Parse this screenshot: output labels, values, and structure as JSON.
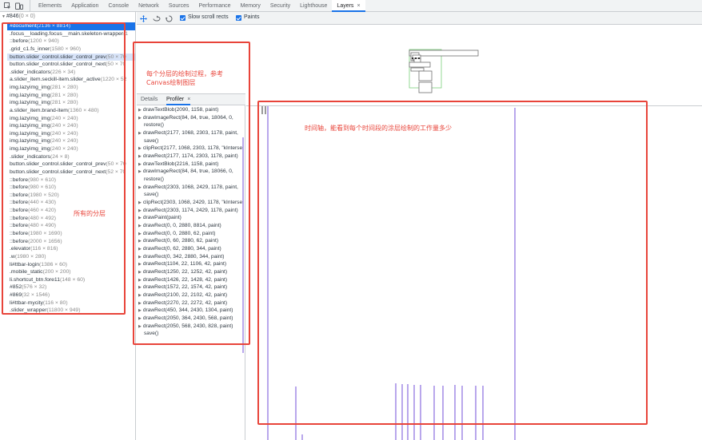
{
  "toolbar": {
    "tabs": [
      {
        "label": "Elements",
        "active": false
      },
      {
        "label": "Application",
        "active": false
      },
      {
        "label": "Console",
        "active": false
      },
      {
        "label": "Network",
        "active": false
      },
      {
        "label": "Sources",
        "active": false
      },
      {
        "label": "Performance",
        "active": false
      },
      {
        "label": "Memory",
        "active": false
      },
      {
        "label": "Security",
        "active": false
      },
      {
        "label": "Lighthouse",
        "active": false
      },
      {
        "label": "Layers",
        "active": true
      }
    ],
    "close_glyph": "×"
  },
  "layer_tree": {
    "root": "#846",
    "root_size": "(0 × 0)",
    "rows": [
      {
        "name": "#document",
        "size": "(2136 × 8814)",
        "selected": true
      },
      {
        "name": ".focus__loading.focus__main.skeleton-wrapper",
        "size": "(1",
        "selected": false
      },
      {
        "name": "::before",
        "size": "(1200 × 940)"
      },
      {
        "name": ".grid_c1.fs_inner",
        "size": "(1580 × 960)"
      },
      {
        "name": "button.slider_control.slider_control_prev",
        "size": "(50 × 70",
        "hover": true
      },
      {
        "name": "button.slider_control.slider_control_next",
        "size": "(50 × 70"
      },
      {
        "name": ".slider_indicators",
        "size": "(226 × 34)"
      },
      {
        "name": "a.slider_item.seckill-item.slider_active",
        "size": "(1220 × 52"
      },
      {
        "name": "img.lazyimg_img",
        "size": "(281 × 280)"
      },
      {
        "name": "img.lazyimg_img",
        "size": "(281 × 280)"
      },
      {
        "name": "img.lazyimg_img",
        "size": "(281 × 280)"
      },
      {
        "name": "a.slider_item.brand-item",
        "size": "(1360 × 480)"
      },
      {
        "name": "img.lazyimg_img",
        "size": "(240 × 240)"
      },
      {
        "name": "img.lazyimg_img",
        "size": "(240 × 240)"
      },
      {
        "name": "img.lazyimg_img",
        "size": "(240 × 240)"
      },
      {
        "name": "img.lazyimg_img",
        "size": "(240 × 240)"
      },
      {
        "name": "img.lazyimg_img",
        "size": "(240 × 240)"
      },
      {
        "name": ".slider_indicators",
        "size": "(24 × 8)"
      },
      {
        "name": "button.slider_control.slider_control_prev",
        "size": "(50 × 70"
      },
      {
        "name": "button.slider_control.slider_control_next",
        "size": "(52 × 70"
      },
      {
        "name": "::before",
        "size": "(980 × 610)"
      },
      {
        "name": "::before",
        "size": "(980 × 610)"
      },
      {
        "name": "::before",
        "size": "(1980 × 520)"
      },
      {
        "name": "::before",
        "size": "(440 × 430)"
      },
      {
        "name": "::before",
        "size": "(460 × 420)"
      },
      {
        "name": "::before",
        "size": "(480 × 492)"
      },
      {
        "name": "::before",
        "size": "(480 × 490)"
      },
      {
        "name": "::before",
        "size": "(1980 × 1690)"
      },
      {
        "name": "::before",
        "size": "(2000 × 1656)"
      },
      {
        "name": ".elevator",
        "size": "(116 × 816)"
      },
      {
        "name": ".w",
        "size": "(1980 × 280)"
      },
      {
        "name": "li#ttbar-login",
        "size": "(1386 × 60)"
      },
      {
        "name": ".mobile_static",
        "size": "(200 × 200)"
      },
      {
        "name": "li.shortcut_btn.fore11",
        "size": "(148 × 60)"
      },
      {
        "name": "#852",
        "size": "(576 × 32)"
      },
      {
        "name": "#869",
        "size": "(32 × 1546)"
      },
      {
        "name": "li#ttbar-mycity",
        "size": "(116 × 80)"
      },
      {
        "name": ".slider_wrapper",
        "size": "(11800 × 949)"
      }
    ]
  },
  "view_toolbar": {
    "slow_scroll_label": "Slow scroll rects",
    "paints_label": "Paints"
  },
  "details": {
    "tab_details": "Details",
    "tab_profiler": "Profiler",
    "tab_close": "×"
  },
  "profiler_commands": [
    {
      "text": "drawTextBlob(2090, 1158, paint)"
    },
    {
      "text": "drawImageRect(84, 84, true, 18064, 0,"
    },
    {
      "text": "restore()",
      "sub": true
    },
    {
      "text": "drawRect(2177, 1068, 2303, 1178, paint,"
    },
    {
      "text": "save()",
      "sub": true
    },
    {
      "text": "clipRect(2177, 1068, 2303, 1178, \"kIntersect\""
    },
    {
      "text": "drawRect(2177, 1174, 2303, 1178, paint)"
    },
    {
      "text": "drawTextBlob(2216, 1158, paint)"
    },
    {
      "text": "drawImageRect(84, 84, true, 18066, 0,"
    },
    {
      "text": "restore()",
      "sub": true
    },
    {
      "text": "drawRect(2303, 1068, 2429, 1178, paint,"
    },
    {
      "text": "save()",
      "sub": true
    },
    {
      "text": "clipRect(2303, 1068, 2429, 1178, \"kIntersect\""
    },
    {
      "text": "drawRect(2303, 1174, 2429, 1178, paint)"
    },
    {
      "text": "drawPaint(paint)"
    },
    {
      "text": "drawRect(0, 0, 2880, 8814, paint)"
    },
    {
      "text": "drawRect(0, 0, 2880, 62, paint)"
    },
    {
      "text": "drawRect(0, 60, 2880, 62, paint)"
    },
    {
      "text": "drawRect(0, 62, 2880, 344, paint)"
    },
    {
      "text": "drawRect(0, 342, 2880, 344, paint)"
    },
    {
      "text": "drawRect(1104, 22, 1106, 42, paint)"
    },
    {
      "text": "drawRect(1250, 22, 1252, 42, paint)"
    },
    {
      "text": "drawRect(1426, 22, 1428, 42, paint)"
    },
    {
      "text": "drawRect(1572, 22, 1574, 42, paint)"
    },
    {
      "text": "drawRect(2100, 22, 2102, 42, paint)"
    },
    {
      "text": "drawRect(2270, 22, 2272, 42, paint)"
    },
    {
      "text": "drawRect(450, 344, 2430, 1304, paint)"
    },
    {
      "text": "drawRect(2050, 364, 2430, 568, paint)"
    },
    {
      "text": "drawRect(2050, 568, 2430, 828, paint)"
    },
    {
      "text": "save()",
      "sub": true
    }
  ],
  "annotations": {
    "layers_note_line1": "所有的分层",
    "profiler_note_line1": "每个分层的绘制过程，参考",
    "profiler_note_line2": "Canvas绘制图层",
    "timeline_note": "时间轴，能看到每个时间段的涂层绘制的工作量多少",
    "color": "#e8443a"
  },
  "timeline": {
    "bar_color": "#b9a7ec"
  }
}
